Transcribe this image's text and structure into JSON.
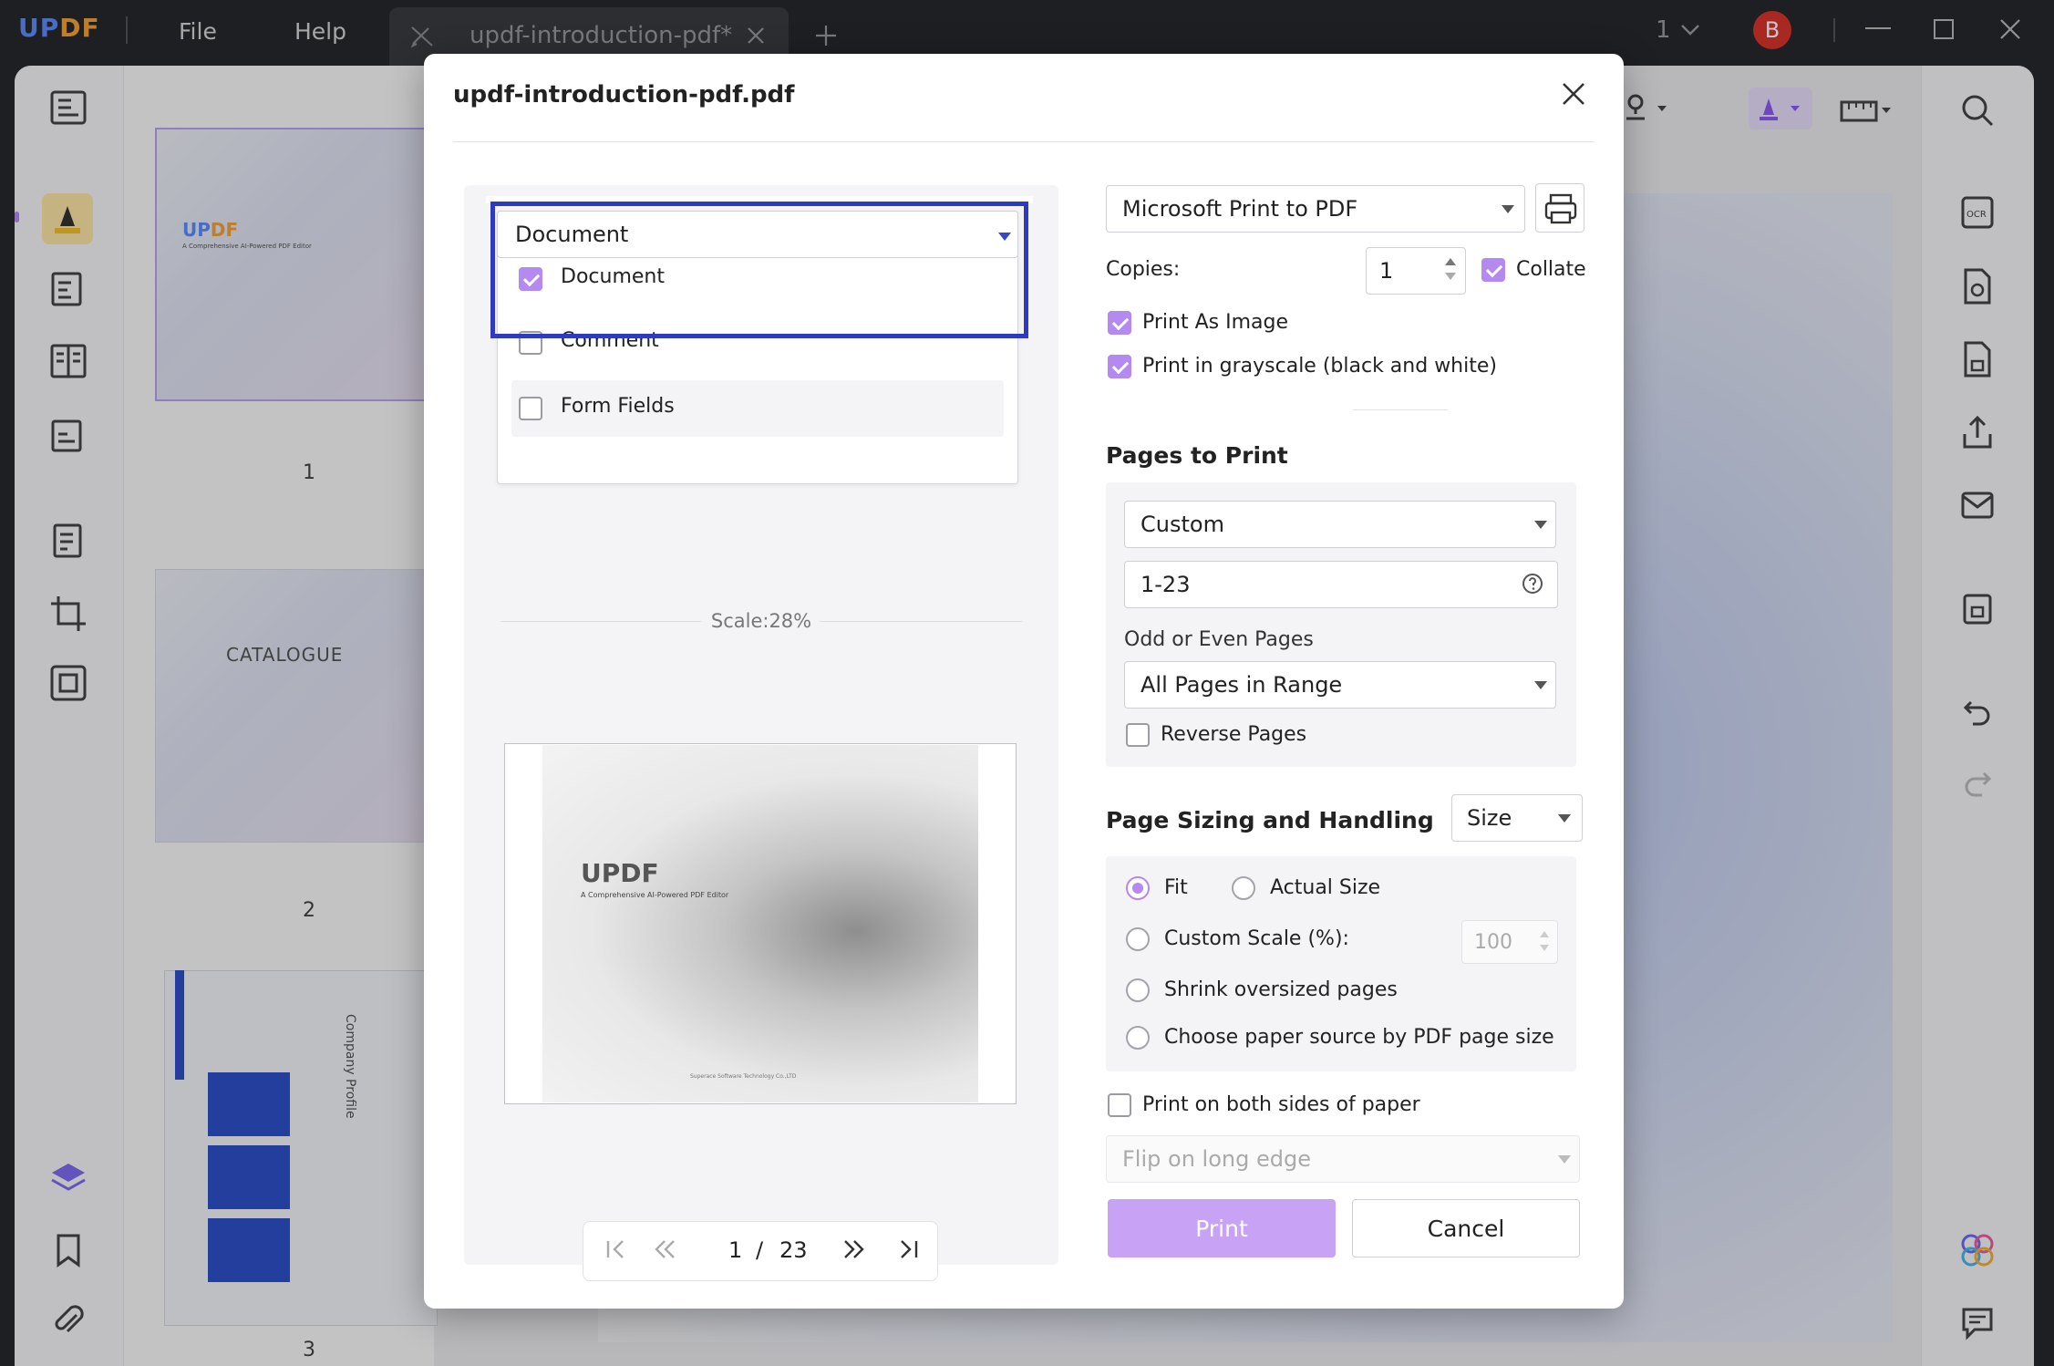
{
  "app": {
    "logo": "UPDF",
    "menu": [
      "File",
      "Help"
    ],
    "tab_title": "updf-introduction-pdf*",
    "page_indicator": "1",
    "avatar_letter": "B"
  },
  "thumbnails": {
    "page1_logo": "UPDF",
    "page1_sub": "A Comprehensive AI-Powered PDF Editor",
    "page2_title": "CATALOGUE",
    "page3_title": "Company Profile",
    "labels": [
      "1",
      "2",
      "3"
    ]
  },
  "dialog": {
    "title": "updf-introduction-pdf.pdf",
    "content_select": {
      "value": "Document",
      "options": [
        {
          "label": "Document",
          "checked": true
        },
        {
          "label": "Comment",
          "checked": false
        },
        {
          "label": "Form Fields",
          "checked": false
        }
      ]
    },
    "scale_label": "Scale:28%",
    "preview": {
      "logo": "UPDF",
      "subtitle": "A Comprehensive AI-Powered PDF Editor",
      "footer": "Superace Software Technology Co.,LTD"
    },
    "nav": {
      "current": "1",
      "separator": "/",
      "total": "23"
    },
    "printer": "Microsoft Print to PDF",
    "copies_label": "Copies:",
    "copies_value": "1",
    "collate_label": "Collate",
    "print_as_image_label": "Print As Image",
    "grayscale_label": "Print in grayscale (black and white)",
    "pages_heading": "Pages to Print",
    "pages_mode": "Custom",
    "pages_range": "1-23",
    "odd_even_label": "Odd or Even Pages",
    "odd_even_value": "All Pages in Range",
    "reverse_label": "Reverse Pages",
    "sizing_heading": "Page Sizing and Handling",
    "sizing_mode": "Size",
    "fit_label": "Fit",
    "actual_size_label": "Actual Size",
    "custom_scale_label": "Custom Scale (%):",
    "custom_scale_value": "100",
    "shrink_label": "Shrink oversized pages",
    "paper_source_label": "Choose paper source by PDF page size",
    "both_sides_label": "Print on both sides of paper",
    "flip_value": "Flip on long edge",
    "print_button": "Print",
    "cancel_button": "Cancel"
  },
  "colors": {
    "accent": "#b489f0",
    "highlight_border": "#2e3bbf"
  }
}
